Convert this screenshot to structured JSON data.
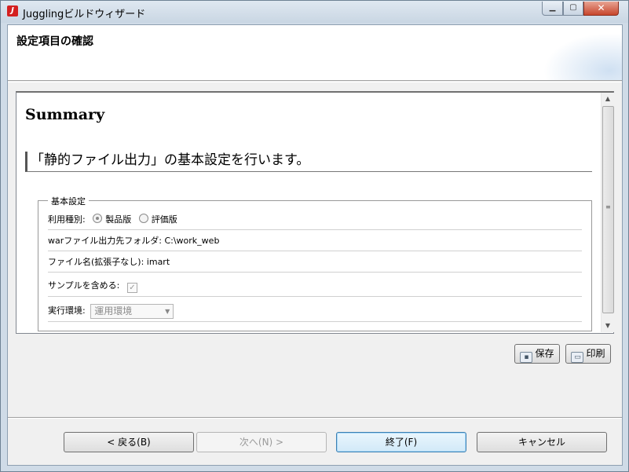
{
  "window": {
    "title": "Jugglingビルドウィザード",
    "min_glyph": "▁",
    "max_glyph": "▢",
    "close_glyph": "✕"
  },
  "header": {
    "title": "設定項目の確認"
  },
  "content": {
    "summary_title": "Summary",
    "section_heading": "「静的ファイル出力」の基本設定を行います。",
    "group_label": "基本設定",
    "usage_type": {
      "label": "利用種別:",
      "options": [
        "製品版",
        "評価版"
      ],
      "selected": "製品版"
    },
    "war_folder": {
      "label": "warファイル出力先フォルダ:",
      "value": "C:\\work_web"
    },
    "file_name": {
      "label": "ファイル名(拡張子なし):",
      "value": "imart"
    },
    "include_sample": {
      "label": "サンプルを含める:",
      "checked": true
    },
    "environment": {
      "label": "実行環境:",
      "value": "運用環境"
    }
  },
  "actions": {
    "save_label": "保存",
    "print_label": "印刷"
  },
  "nav": {
    "back": "< 戻る(B)",
    "next": "次へ(N) >",
    "finish": "終了(F)",
    "cancel": "キャンセル"
  },
  "colors": {
    "brand_icon": "#d42020",
    "close_button": "#c7462c",
    "focus_border": "#3c7fb1"
  }
}
